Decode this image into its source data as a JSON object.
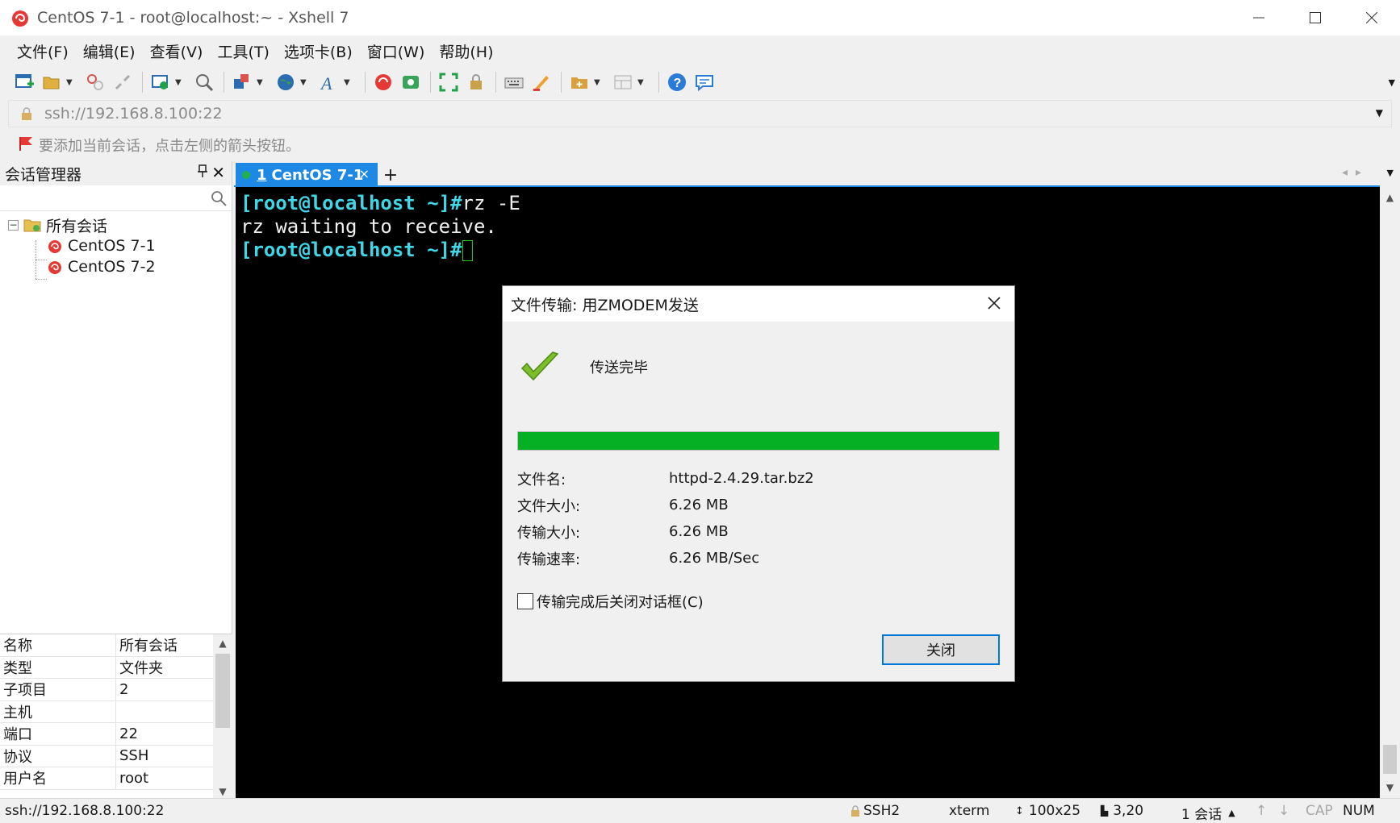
{
  "window": {
    "title": "CentOS 7-1 - root@localhost:~ - Xshell 7",
    "minimize_glyph": "—",
    "maximize_glyph": "☐",
    "close_glyph": "✕"
  },
  "menu": {
    "items": [
      "文件(F)",
      "编辑(E)",
      "查看(V)",
      "工具(T)",
      "选项卡(B)",
      "窗口(W)",
      "帮助(H)"
    ]
  },
  "address_bar": {
    "value": "ssh://192.168.8.100:22"
  },
  "hint_bar": {
    "text": "要添加当前会话，点击左侧的箭头按钮。"
  },
  "session_manager": {
    "title": "会话管理器",
    "pin_glyph": "📌",
    "close_glyph": "✕",
    "tree": {
      "root": "所有会话",
      "expander": "−",
      "children": [
        "CentOS 7-1",
        "CentOS 7-2"
      ]
    },
    "properties": [
      {
        "key": "名称",
        "value": "所有会话"
      },
      {
        "key": "类型",
        "value": "文件夹"
      },
      {
        "key": "子项目",
        "value": "2"
      },
      {
        "key": "主机",
        "value": ""
      },
      {
        "key": "端口",
        "value": "22"
      },
      {
        "key": "协议",
        "value": "SSH"
      },
      {
        "key": "用户名",
        "value": "root"
      }
    ]
  },
  "tabs": {
    "active": {
      "number": "1",
      "label": "CentOS 7-1",
      "close_glyph": "×"
    },
    "new_tab_glyph": "+"
  },
  "terminal": {
    "lines": [
      {
        "prompt": "[root@localhost ~]#",
        "text": "rz -E"
      },
      {
        "prompt": "",
        "text": "rz waiting to receive."
      },
      {
        "prompt": "[root@localhost ~]#",
        "text": ""
      }
    ]
  },
  "dialog": {
    "title": "文件传输: 用ZMODEM发送",
    "status": "传送完毕",
    "progress_percent": 100,
    "info": [
      {
        "key": "文件名:",
        "value": "httpd-2.4.29.tar.bz2"
      },
      {
        "key": "文件大小:",
        "value": "6.26 MB"
      },
      {
        "key": "传输大小:",
        "value": "6.26 MB"
      },
      {
        "key": "传输速率:",
        "value": "6.26 MB/Sec"
      }
    ],
    "checkbox_label": "传输完成后关闭对话框(C)",
    "checkbox_checked": false,
    "close_button": "关闭"
  },
  "status_bar": {
    "connection": "ssh://192.168.8.100:22",
    "protocol": "SSH2",
    "terminal_type": "xterm",
    "size": "100x25",
    "cursor_pos": "3,20",
    "sessions": "1 会话",
    "cap": "CAP",
    "num": "NUM"
  },
  "colors": {
    "accent": "#1e88e5",
    "progress": "#06b025",
    "prompt": "#3fd6e8",
    "terminal_bg": "#000000"
  }
}
